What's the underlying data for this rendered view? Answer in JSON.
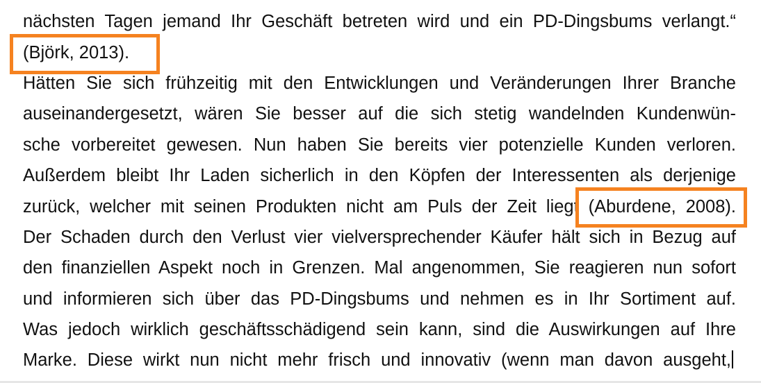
{
  "document": {
    "lines": [
      {
        "text": "nächsten Tagen jemand Ihr Geschäft betreten wird und ein PD-Dingsbums verlangt.“"
      },
      {
        "text": "(Björk, 2013)."
      },
      {
        "text": "Hätten Sie sich frühzeitig mit den Entwicklungen und Veränderungen Ihrer Branche"
      },
      {
        "text": "auseinandergesetzt, wären Sie besser auf die sich stetig wandelnden Kundenwün-"
      },
      {
        "text": "sche vorbereitet gewesen. Nun haben Sie bereits vier potenzielle Kunden verloren."
      },
      {
        "text": "Außerdem bleibt Ihr Laden sicherlich in den Köpfen der Interessenten als derjenige"
      },
      {
        "text": "zurück, welcher mit seinen Produkten nicht am Puls der Zeit liegt (Aburdene, 2008)."
      },
      {
        "text": "Der Schaden durch den Verlust vier vielversprechender Käufer hält sich in Bezug auf"
      },
      {
        "text": "den finanziellen Aspekt noch in Grenzen. Mal angenommen, Sie reagieren nun sofort"
      },
      {
        "text": "und informieren sich über das PD-Dingsbums und nehmen es in Ihr Sortiment auf."
      },
      {
        "text": "Was jedoch wirklich geschäftsschädigend sein kann, sind die Auswirkungen auf Ihre"
      },
      {
        "text": "Marke. Diese wirkt nun nicht mehr frisch und innovativ (wenn man davon ausgeht,"
      }
    ]
  },
  "highlight_color": "#f58220"
}
